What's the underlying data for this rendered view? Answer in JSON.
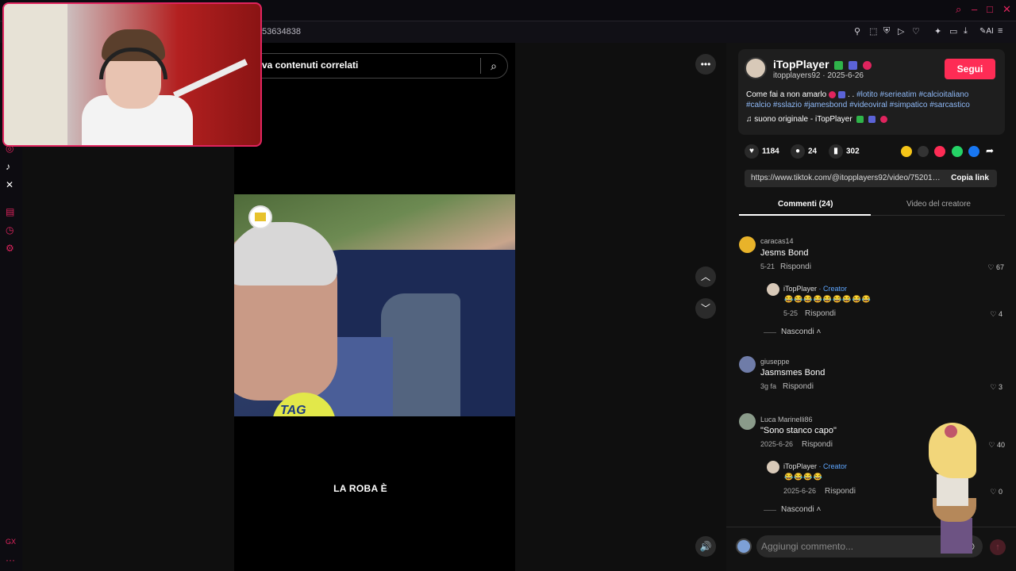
{
  "browser": {
    "address": "53634838",
    "ai_label": "AI"
  },
  "search": {
    "text": "va contenuti correlati"
  },
  "video": {
    "caption": "LA ROBA È",
    "mic_text": "TAG"
  },
  "post": {
    "author_name": "iTopPlayer",
    "author_handle": "itopplayers92",
    "date": "2025-6-26",
    "follow_label": "Segui",
    "desc_plain": "Come fai a non amarlo",
    "desc_dots": " . . ",
    "tags_line1": "#lotito #serieatim #calcioitaliano",
    "tags_line2": "#calcio #sslazio #jamesbond #videoviral #simpatico #sarcastico",
    "sound": "suono originale - iTopPlayer",
    "likes": "1184",
    "comments": "24",
    "saves": "302",
    "link": "https://www.tiktok.com/@itopplayers92/video/752019...",
    "copy_label": "Copia link"
  },
  "tabs": {
    "comments": "Commenti (24)",
    "creator_videos": "Video del creatore"
  },
  "comments": [
    {
      "user": "caracas14",
      "text": "Jesms Bond",
      "date": "5-21",
      "reply_label": "Rispondi",
      "likes": "67",
      "reply": {
        "user": "iTopPlayer",
        "creator_label": "· Creator",
        "emojis": "😂😂😂😂😂😂😂😂😂",
        "date": "5-25",
        "reply_label": "Rispondi",
        "likes": "4"
      },
      "hide_label": "Nascondi"
    },
    {
      "user": "giuseppe",
      "text": "Jasmsmes Bond",
      "date": "3g fa",
      "reply_label": "Rispondi",
      "likes": "3"
    },
    {
      "user": "Luca Marinelli86",
      "text": "\"Sono stanco capo\"",
      "date": "2025-6-26",
      "reply_label": "Rispondi",
      "likes": "40",
      "reply": {
        "user": "iTopPlayer",
        "creator_label": "· Creator",
        "emojis": "😂😂😂😂",
        "date": "2025-6-26",
        "reply_label": "Rispondi",
        "likes": "0"
      },
      "hide_label": "Nascondi"
    }
  ],
  "composer": {
    "placeholder": "Aggiungi commento..."
  },
  "colors": {
    "accent": "#fe2c55",
    "tag": "#8fb9f7",
    "creator": "#5ea6ff"
  }
}
